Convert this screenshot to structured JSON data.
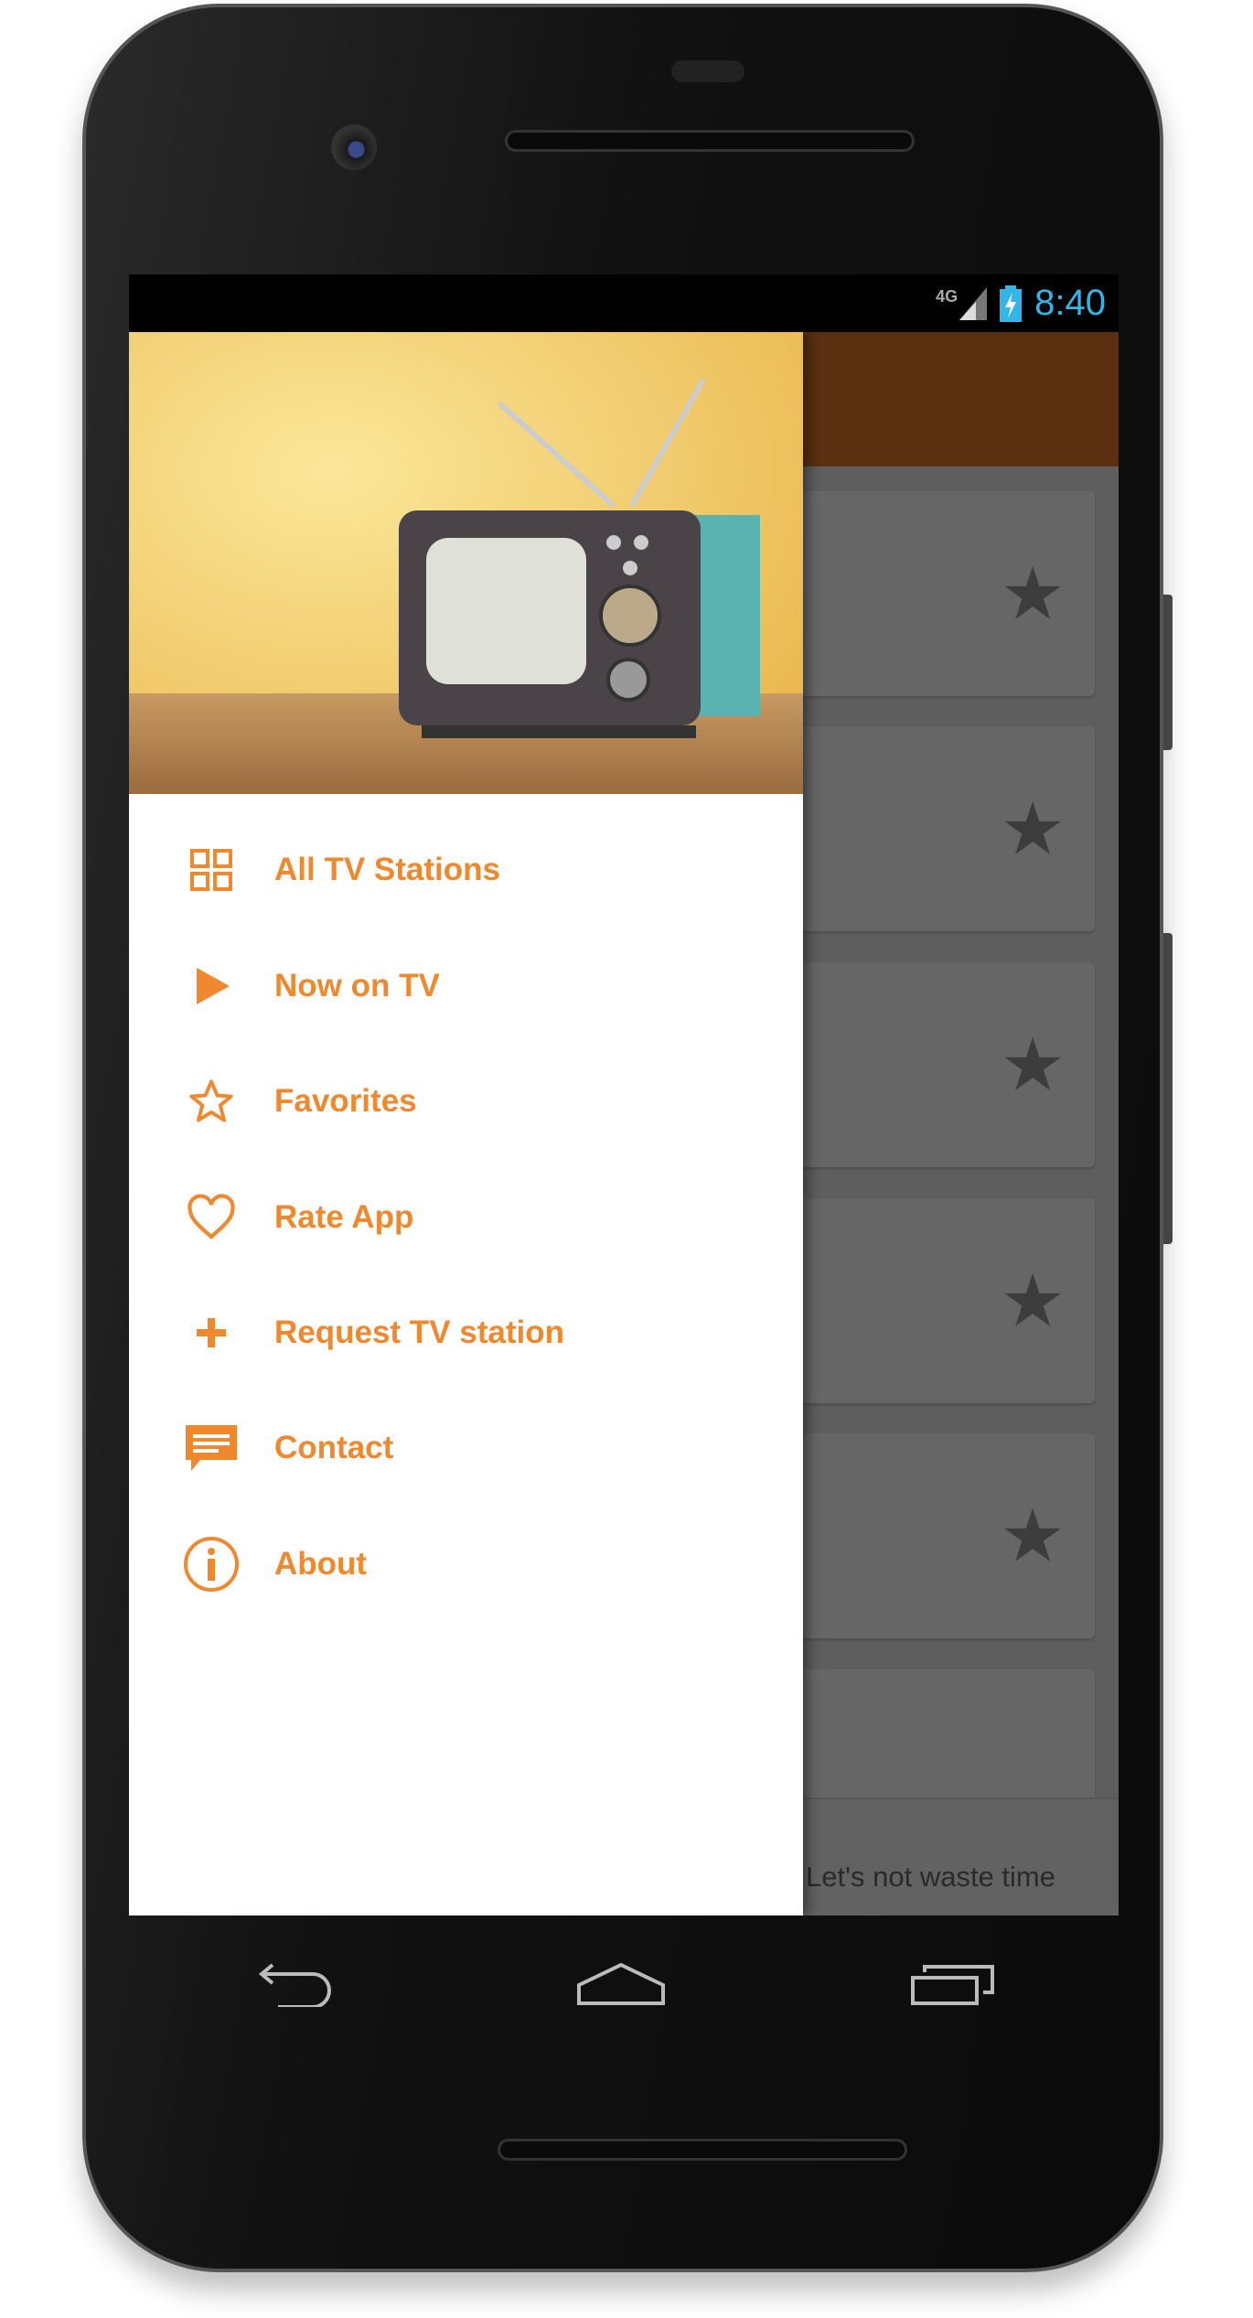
{
  "status_bar": {
    "network": "4G",
    "time": "8:40"
  },
  "drawer": {
    "items": [
      {
        "label": "All TV Stations",
        "icon": "grid-icon"
      },
      {
        "label": "Now on TV",
        "icon": "play-icon"
      },
      {
        "label": "Favorites",
        "icon": "star-icon"
      },
      {
        "label": "Rate App",
        "icon": "heart-icon"
      },
      {
        "label": "Request TV station",
        "icon": "plus-icon"
      },
      {
        "label": "Contact",
        "icon": "message-icon"
      },
      {
        "label": "About",
        "icon": "info-icon"
      }
    ]
  },
  "main": {
    "bottom_text": "Let's not waste time",
    "card_icon": "★"
  },
  "colors": {
    "accent": "#f0882e",
    "toolbar": "#e0792a",
    "status_time": "#33b5e5"
  }
}
